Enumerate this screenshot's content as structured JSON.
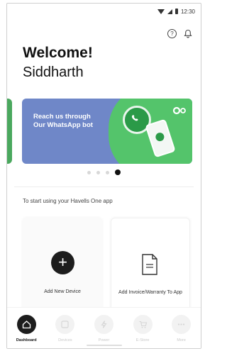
{
  "status_bar": {
    "time": "12:30"
  },
  "header": {
    "welcome": "Welcome!",
    "user_name": "Siddharth"
  },
  "banner": {
    "text": "Reach us through Our WhatsApp bot",
    "slides_count": 4,
    "active_slide": 4
  },
  "intro": {
    "text": "To start using your Havells One app"
  },
  "cards": {
    "add_device": {
      "label": "Add New Device"
    },
    "add_invoice": {
      "label": "Add Invoice/Warranty To App"
    }
  },
  "nav": {
    "items": [
      {
        "label": "Dashboard",
        "active": true
      },
      {
        "label": "Devices"
      },
      {
        "label": "Power"
      },
      {
        "label": "E-Store"
      },
      {
        "label": "More"
      }
    ]
  },
  "colors": {
    "banner_bg": "#6f87c8",
    "whatsapp_green": "#54c46b",
    "dark": "#1d1d1d"
  }
}
